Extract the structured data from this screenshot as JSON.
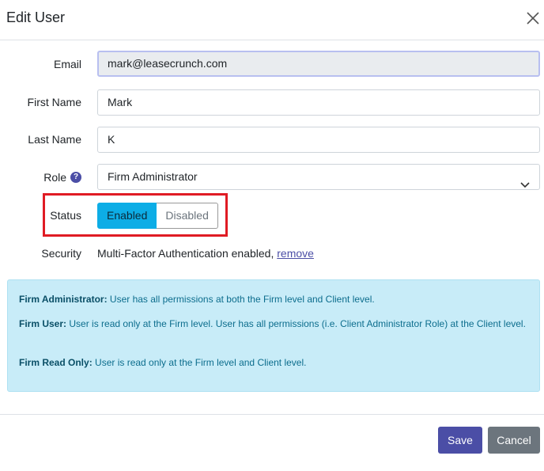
{
  "modal": {
    "title": "Edit User"
  },
  "form": {
    "email": {
      "label": "Email",
      "value": "mark@leasecrunch.com"
    },
    "first_name": {
      "label": "First Name",
      "value": "Mark"
    },
    "last_name": {
      "label": "Last Name",
      "value": "K"
    },
    "role": {
      "label": "Role",
      "help": "?",
      "value": "Firm Administrator"
    },
    "status": {
      "label": "Status",
      "options": [
        "Enabled",
        "Disabled"
      ],
      "selected": "Enabled"
    },
    "security": {
      "label": "Security",
      "text": "Multi-Factor Authentication enabled,",
      "link": "remove"
    }
  },
  "info": [
    {
      "term": "Firm Administrator:",
      "desc": " User has all permissions at both the Firm level and Client level."
    },
    {
      "term": "Firm User:",
      "desc": " User is read only at the Firm level. User has all permissions (i.e. Client Administrator Role) at the Client level."
    },
    {
      "term": "Firm Read Only:",
      "desc": " User is read only at the Firm level and Client level."
    }
  ],
  "footer": {
    "save_label": "Save",
    "cancel_label": "Cancel"
  },
  "colors": {
    "accent": "#4b4ea6",
    "toggle_on": "#0dade6",
    "highlight": "#e01b24",
    "info_bg": "#c8ecf8"
  }
}
